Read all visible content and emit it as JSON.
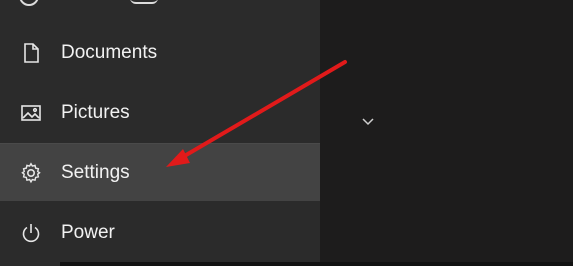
{
  "start_menu": {
    "items": [
      {
        "label": "Documents",
        "icon": "document-icon"
      },
      {
        "label": "Pictures",
        "icon": "pictures-icon"
      },
      {
        "label": "Settings",
        "icon": "gear-icon"
      },
      {
        "label": "Power",
        "icon": "power-icon"
      }
    ],
    "selected": "Settings"
  },
  "annotation": {
    "type": "arrow",
    "color": "#e11a1a"
  },
  "colors": {
    "menu_bg": "#2b2b2b",
    "selected_bg": "#434343",
    "text": "#f2f2f2",
    "desktop_bg": "#1d1c1c"
  }
}
